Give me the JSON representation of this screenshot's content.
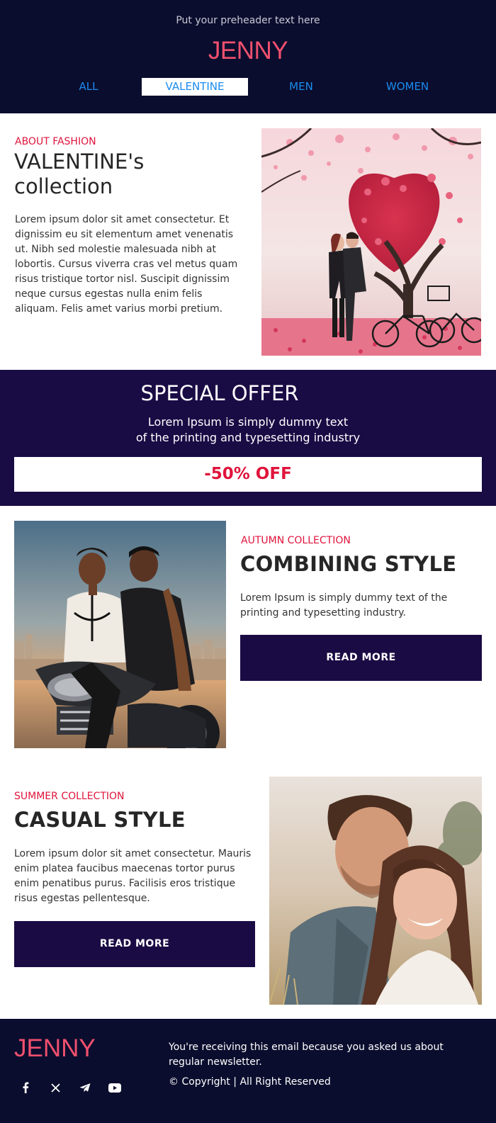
{
  "header": {
    "preheader": "Put your preheader text here",
    "logo": "JENNY",
    "nav": [
      "ALL",
      "VALENTINE",
      "MEN",
      "WOMEN"
    ]
  },
  "hero": {
    "eyebrow": "ABOUT FASHION",
    "title_line1": "VALENTINE's",
    "title_line2": "collection",
    "text": "Lorem ipsum dolor sit amet consectetur. Et dignissim eu sit elementum amet venenatis ut. Nibh sed molestie malesuada nibh at lobortis. Cursus viverra cras vel metus quam risus tristique tortor nisl. Suscipit dignissim neque cursus egestas nulla enim felis aliquam. Felis amet varius morbi pretium."
  },
  "offer": {
    "title": "SPECIAL OFFER",
    "line1": "Lorem Ipsum is simply dummy text",
    "line2": "of the printing and typesetting industry",
    "button": "-50% OFF"
  },
  "autumn": {
    "eyebrow": "AUTUMN COLLECTION",
    "title": "COMBINING STYLE",
    "text": "Lorem Ipsum is simply dummy text of the printing and typesetting industry.",
    "button": "READ MORE"
  },
  "summer": {
    "eyebrow": "SUMMER COLLECTION",
    "title": "CASUAL STYLE",
    "text": "Lorem ipsum dolor sit amet consectetur. Mauris enim platea faucibus maecenas tortor purus enim penatibus purus. Facilisis eros tristique risus egestas pellentesque.",
    "button": "READ MORE"
  },
  "footer": {
    "logo": "JENNY",
    "text": "You're receiving this email because you asked us about regular newsletter.",
    "copyright": "© Copyright | All Right Reserved",
    "social": [
      "facebook-icon",
      "x-icon",
      "telegram-icon",
      "youtube-icon"
    ]
  },
  "colors": {
    "header_bg": "#0b0d2e",
    "offer_bg": "#190c45",
    "button_bg": "#1b0b44",
    "accent_pink": "#f0506e",
    "accent_red": "#e0143c",
    "link_blue": "#1a8cf0"
  }
}
